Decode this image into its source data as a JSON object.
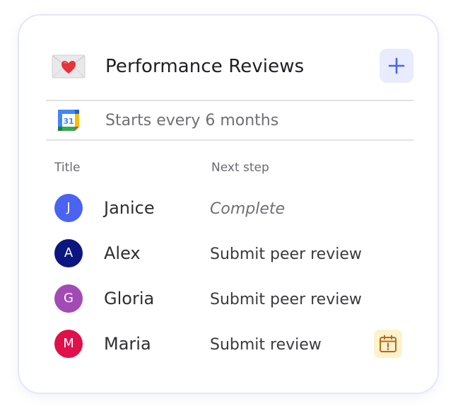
{
  "card": {
    "title": "Performance Reviews",
    "title_icon": "envelope-heart-icon",
    "add_button_icon": "plus-icon",
    "schedule_icon": "calendar-31-icon",
    "schedule_text": "Starts every 6 months"
  },
  "columns": {
    "title": "Title",
    "next_step": "Next step"
  },
  "rows": [
    {
      "initial": "J",
      "name": "Janice",
      "step": "Complete",
      "avatar_color": "#4a63f0",
      "complete": true
    },
    {
      "initial": "A",
      "name": "Alex",
      "step": "Submit peer review",
      "avatar_color": "#0c1680",
      "complete": false
    },
    {
      "initial": "G",
      "name": "Gloria",
      "step": "Submit peer review",
      "avatar_color": "#a24bb5",
      "complete": false
    },
    {
      "initial": "M",
      "name": "Maria",
      "step": "Submit review",
      "avatar_color": "#e0104a",
      "complete": false,
      "flag_icon": "calendar-alert-icon"
    }
  ],
  "colors": {
    "accent": "#4a63f0",
    "warning_bg": "#fdf2cc",
    "warning_fg": "#b06a1c"
  }
}
